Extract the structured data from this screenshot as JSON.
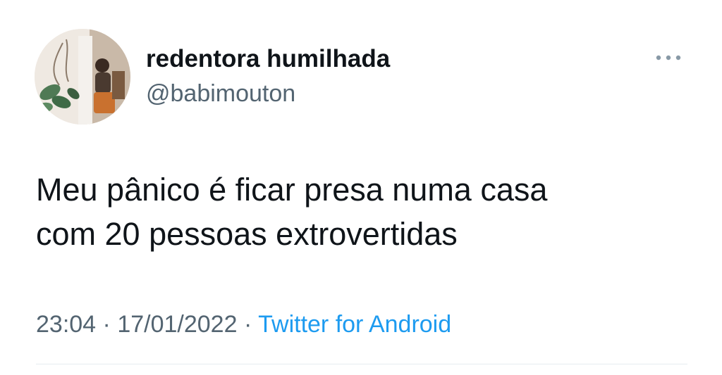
{
  "author": {
    "display_name": "redentora humilhada",
    "handle": "@babimouton",
    "avatar_icon": "profile-photo"
  },
  "more_icon": "more-horizontal-icon",
  "tweet": {
    "text_lines": [
      "Meu pânico é ficar presa numa casa",
      "com 20 pessoas extrovertidas"
    ],
    "time": "23:04",
    "separator": "·",
    "date": "17/01/2022",
    "source": "Twitter for Android"
  },
  "colors": {
    "primary_text": "#0f1419",
    "secondary_text": "#536471",
    "link": "#1d9bf0",
    "divider": "#e6ecf0"
  }
}
